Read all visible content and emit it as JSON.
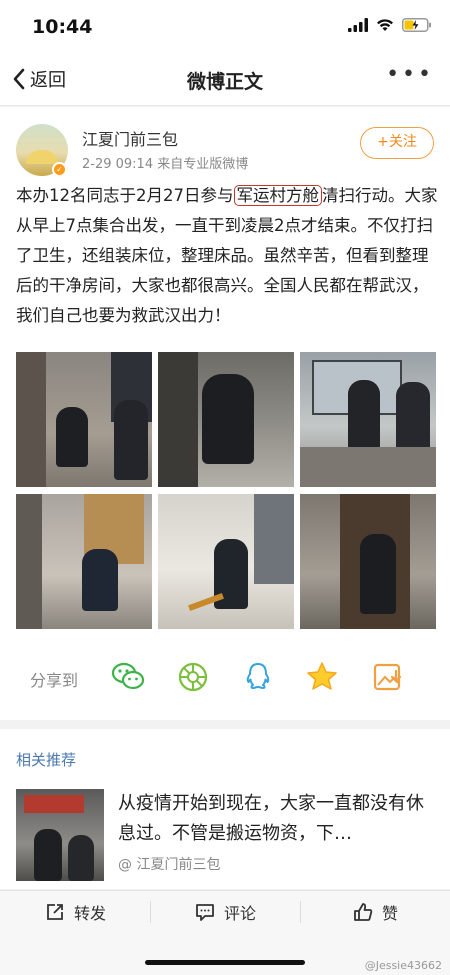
{
  "status_bar": {
    "time": "10:44"
  },
  "nav": {
    "back_label": "返回",
    "title": "微博正文",
    "more": "•••"
  },
  "post": {
    "user_name": "江夏门前三包",
    "meta": "2-29 09:14  来自专业版微博",
    "follow_label": "+关注",
    "text_before": "本办12名同志于2月27日参与",
    "text_highlight": "军运村方舱",
    "text_after": "清扫行动。大家从早上7点集合出发，一直干到凌晨2点才结束。不仅打扫了卫生，还组装床位，整理床品。虽然辛苦，但看到整理后的干净房间，大家也都很高兴。全国人民都在帮武汉，我们自己也要为救武汉出力！",
    "share_label": "分享到",
    "share_icons": [
      "wechat-icon",
      "moments-icon",
      "qq-icon",
      "qzone-star-icon",
      "save-image-icon"
    ]
  },
  "related": {
    "title": "相关推荐",
    "text": "从疫情开始到现在，大家一直都没有休息过。不管是搬运物资，下…",
    "user": "@ 江夏门前三包"
  },
  "actions": {
    "repost": "转发",
    "comment": "评论",
    "like": "赞"
  },
  "watermark": "@Jessie43662",
  "colors": {
    "accent_orange": "#f08a20",
    "link_blue": "#4a78b0",
    "highlight_red": "#c0392b"
  }
}
